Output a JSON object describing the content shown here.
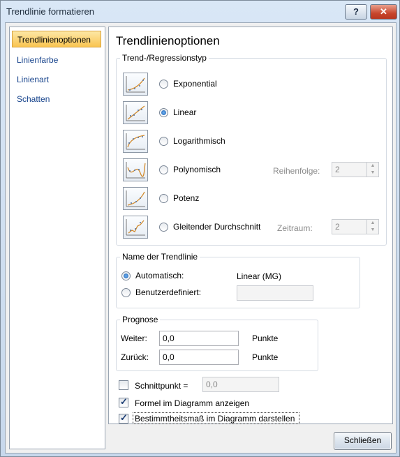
{
  "window": {
    "title": "Trendlinie formatieren",
    "help_label": "?",
    "close_label": "✕"
  },
  "sidebar": {
    "items": [
      {
        "label": "Trendlinienoptionen",
        "active": true
      },
      {
        "label": "Linienfarbe",
        "active": false
      },
      {
        "label": "Linienart",
        "active": false
      },
      {
        "label": "Schatten",
        "active": false
      }
    ]
  },
  "panel": {
    "title": "Trendlinienoptionen",
    "trend_group": {
      "label": "Trend-/Regressionstyp",
      "options": [
        {
          "label": "Exponential",
          "selected": false
        },
        {
          "label": "Linear",
          "selected": true
        },
        {
          "label": "Logarithmisch",
          "selected": false
        },
        {
          "label": "Polynomisch",
          "selected": false
        },
        {
          "label": "Potenz",
          "selected": false
        },
        {
          "label": "Gleitender Durchschnitt",
          "selected": false
        }
      ],
      "order_label": "Reihenfolge:",
      "order_value": "2",
      "period_label": "Zeitraum:",
      "period_value": "2"
    },
    "name_group": {
      "label": "Name der Trendlinie",
      "auto_label": "Automatisch:",
      "auto_value": "Linear (MG)",
      "custom_label": "Benutzerdefiniert:",
      "custom_value": ""
    },
    "forecast_group": {
      "label": "Prognose",
      "forward_label": "Weiter:",
      "forward_value": "0,0",
      "forward_unit": "Punkte",
      "backward_label": "Zurück:",
      "backward_value": "0,0",
      "backward_unit": "Punkte"
    },
    "intercept": {
      "label": "Schnittpunkt =",
      "value": "0,0",
      "checked": false
    },
    "show_equation": {
      "label": "Formel im Diagramm anzeigen",
      "checked": true
    },
    "show_r2": {
      "label": "Bestimmtheitsmaß im Diagramm darstellen",
      "checked": true
    }
  },
  "footer": {
    "close_label": "Schließen"
  }
}
